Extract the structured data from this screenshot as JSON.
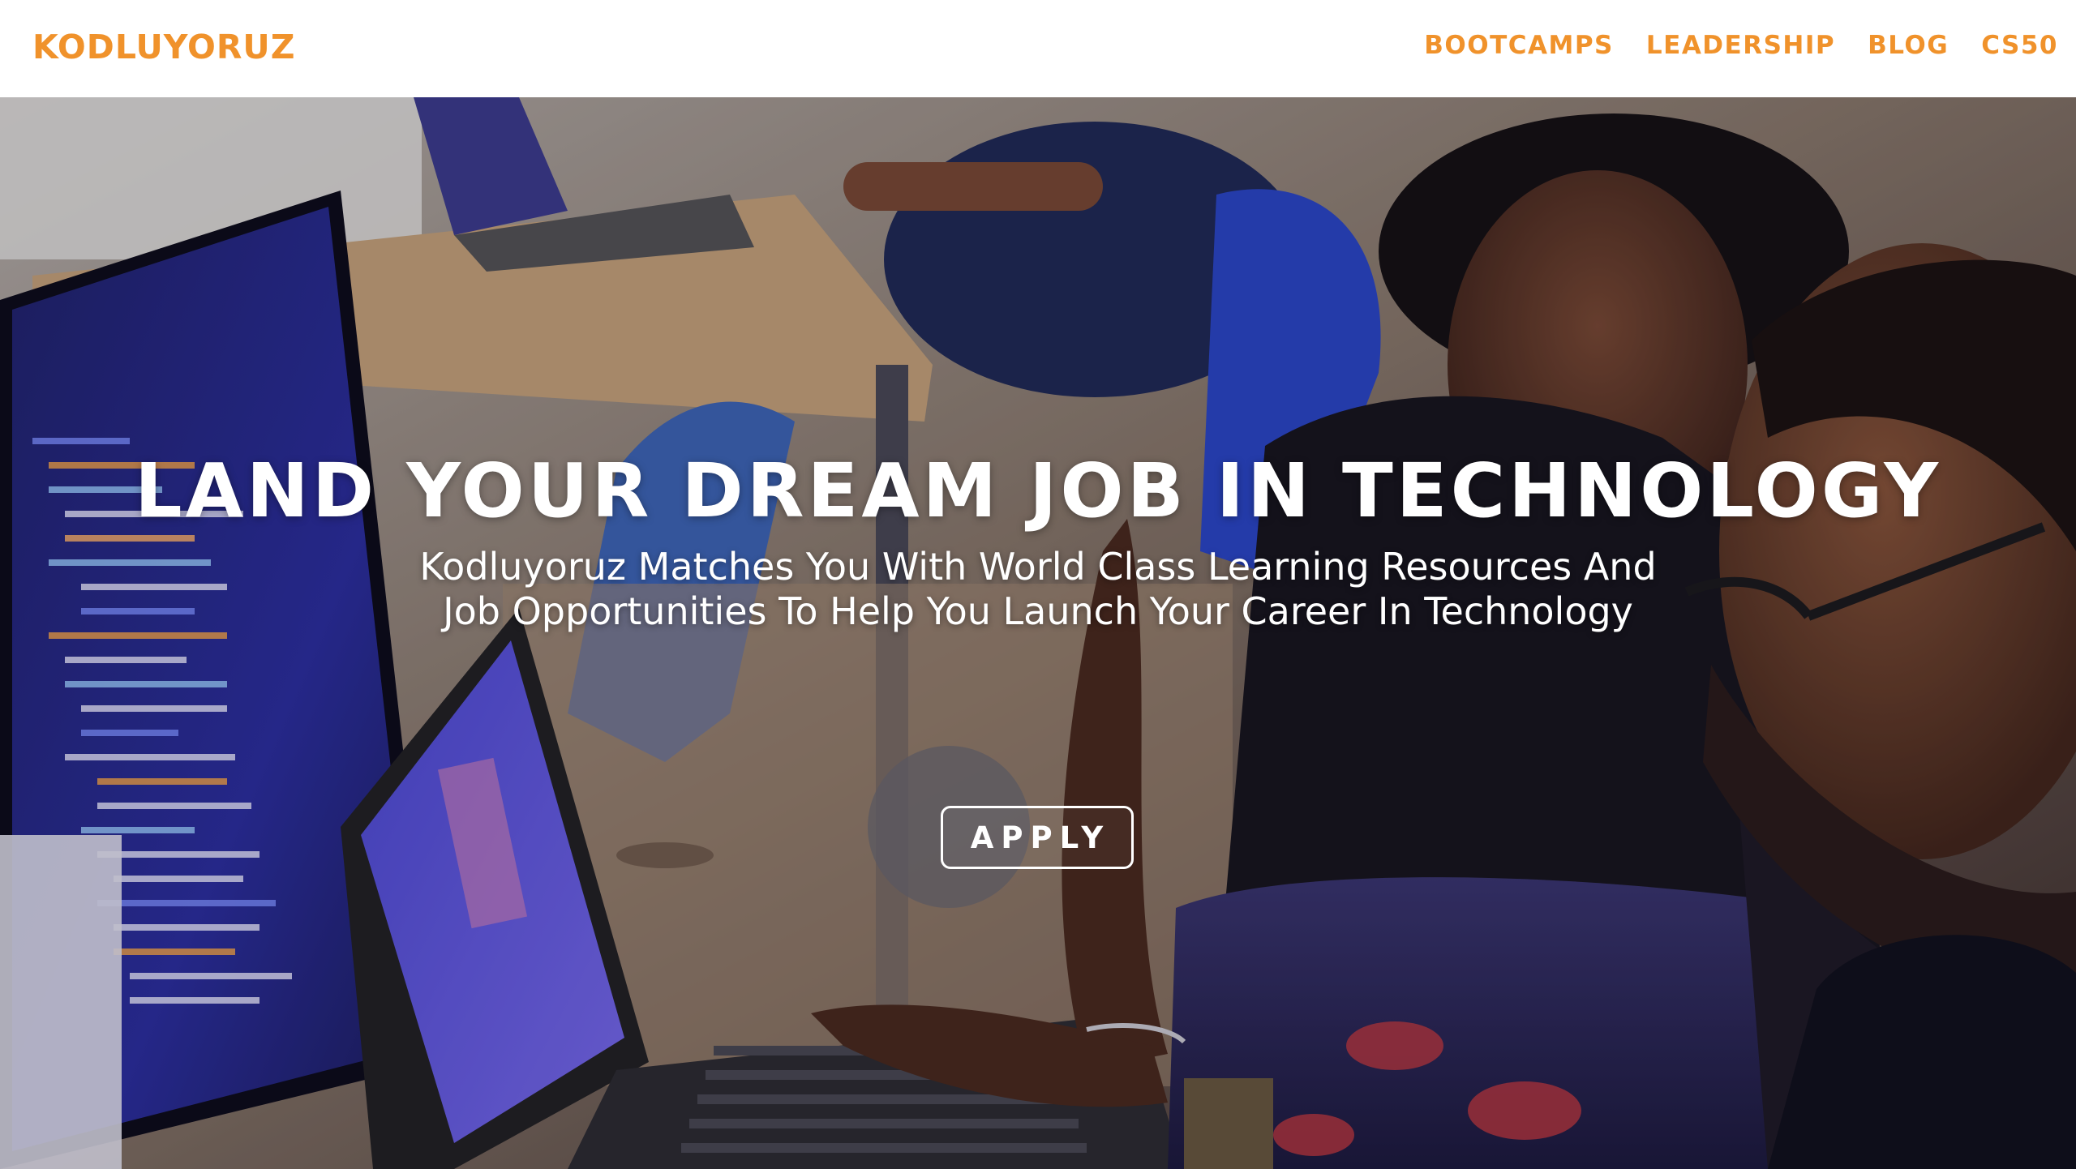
{
  "header": {
    "logo_text": "KODLUYORUZ",
    "nav": [
      {
        "label": "BOOTCAMPS"
      },
      {
        "label": "LEADERSHIP"
      },
      {
        "label": "BLOG"
      },
      {
        "label": "CS50"
      }
    ]
  },
  "hero": {
    "title": "LAND YOUR DREAM JOB IN TECHNOLOGY",
    "subtitle": "Kodluyoruz Matches You With World Class Learning Resources And Job Opportunities To Help You Launch Your Career In Technology",
    "cta_label": "APPLY",
    "background_image": "photo of people working at computers in a classroom"
  },
  "colors": {
    "brand": "#f0922b",
    "header_bg": "#ffffff",
    "hero_text": "#ffffff"
  }
}
